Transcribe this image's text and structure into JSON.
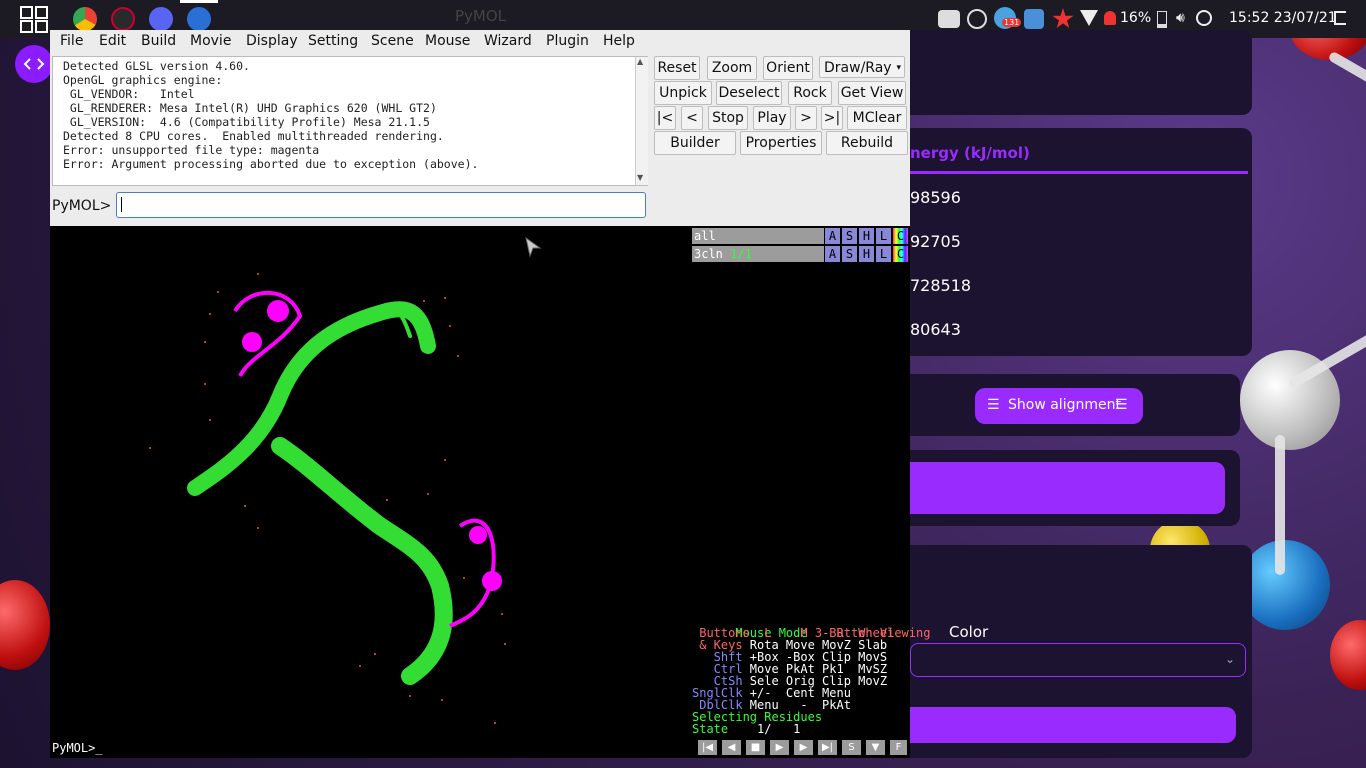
{
  "colors": {
    "accent": "#9a2bff",
    "protein_green": "#33dd33",
    "protein_magenta": "#ff00ff"
  },
  "topbar": {
    "window_title": "PyMOL",
    "apps": [
      "app-grid-icon",
      "chrome-icon",
      "settings-cog-icon",
      "discord-icon",
      "network-icon"
    ],
    "tray": {
      "notif_count": "131",
      "battery": "16%",
      "clock": "15:52 23/07/21"
    }
  },
  "right_panel": {
    "header": "nergy (kJ/mol)",
    "values": [
      "98596",
      "92705",
      "728518",
      "80643"
    ],
    "show_alignment": "Show alignment",
    "color_label": "Color"
  },
  "pymol": {
    "menu": [
      "File",
      "Edit",
      "Build",
      "Movie",
      "Display",
      "Setting",
      "Scene",
      "Mouse",
      "Wizard",
      "Plugin",
      "Help"
    ],
    "console_lines": [
      "Detected GLSL version 4.60.",
      "OpenGL graphics engine:",
      " GL_VENDOR:   Intel",
      " GL_RENDERER: Mesa Intel(R) UHD Graphics 620 (WHL GT2)",
      " GL_VERSION:  4.6 (Compatibility Profile) Mesa 21.1.5",
      "Detected 8 CPU cores.  Enabled multithreaded rendering.",
      "Error: unsupported file type: magenta",
      "Error: Argument processing aborted due to exception (above)."
    ],
    "buttons": {
      "reset": "Reset",
      "zoom": "Zoom",
      "orient": "Orient",
      "draw_ray": "Draw/Ray",
      "unpick": "Unpick",
      "deselect": "Deselect",
      "rock": "Rock",
      "get_view": "Get View",
      "first": "|<",
      "prev": "<",
      "stop": "Stop",
      "play": "Play",
      "next": ">",
      "last": ">|",
      "mclear": "MClear",
      "builder": "Builder",
      "properties": "Properties",
      "rebuild": "Rebuild"
    },
    "cmd_label": "PyMOL>",
    "cmd_value": "",
    "objects": [
      {
        "name": "all",
        "state": ""
      },
      {
        "name": "3cln",
        "state": "1/1"
      }
    ],
    "obj_buttons": [
      "A",
      "S",
      "H",
      "L",
      "C"
    ],
    "mouse_mode": {
      "l1a": "Mouse Mode ",
      "l1b": "3-Button Viewing",
      "l2": " Buttons  L    M    R  Wheel",
      "l3a": " & Keys ",
      "l3b": "Rota Move MovZ Slab",
      "l4a": "   Shft ",
      "l4b": "+Box -Box Clip MovS",
      "l5a": "   Ctrl ",
      "l5b": "Move PkAt Pk1  MvSZ",
      "l6a": "   CtSh ",
      "l6b": "Sele Orig Clip MovZ",
      "l7a": "SnglClk ",
      "l7b": "+/-  Cent Menu",
      "l8a": " DblClk ",
      "l8b": "Menu   -  PkAt",
      "l9": "Selecting Residues",
      "l10a": "State ",
      "l10b": "   1/   1"
    },
    "bottom_prompt": "PyMOL>_",
    "playbar": [
      "|◀",
      "◀",
      "■",
      "▶",
      "▶",
      "▶|",
      "S",
      "▼",
      "F"
    ]
  }
}
